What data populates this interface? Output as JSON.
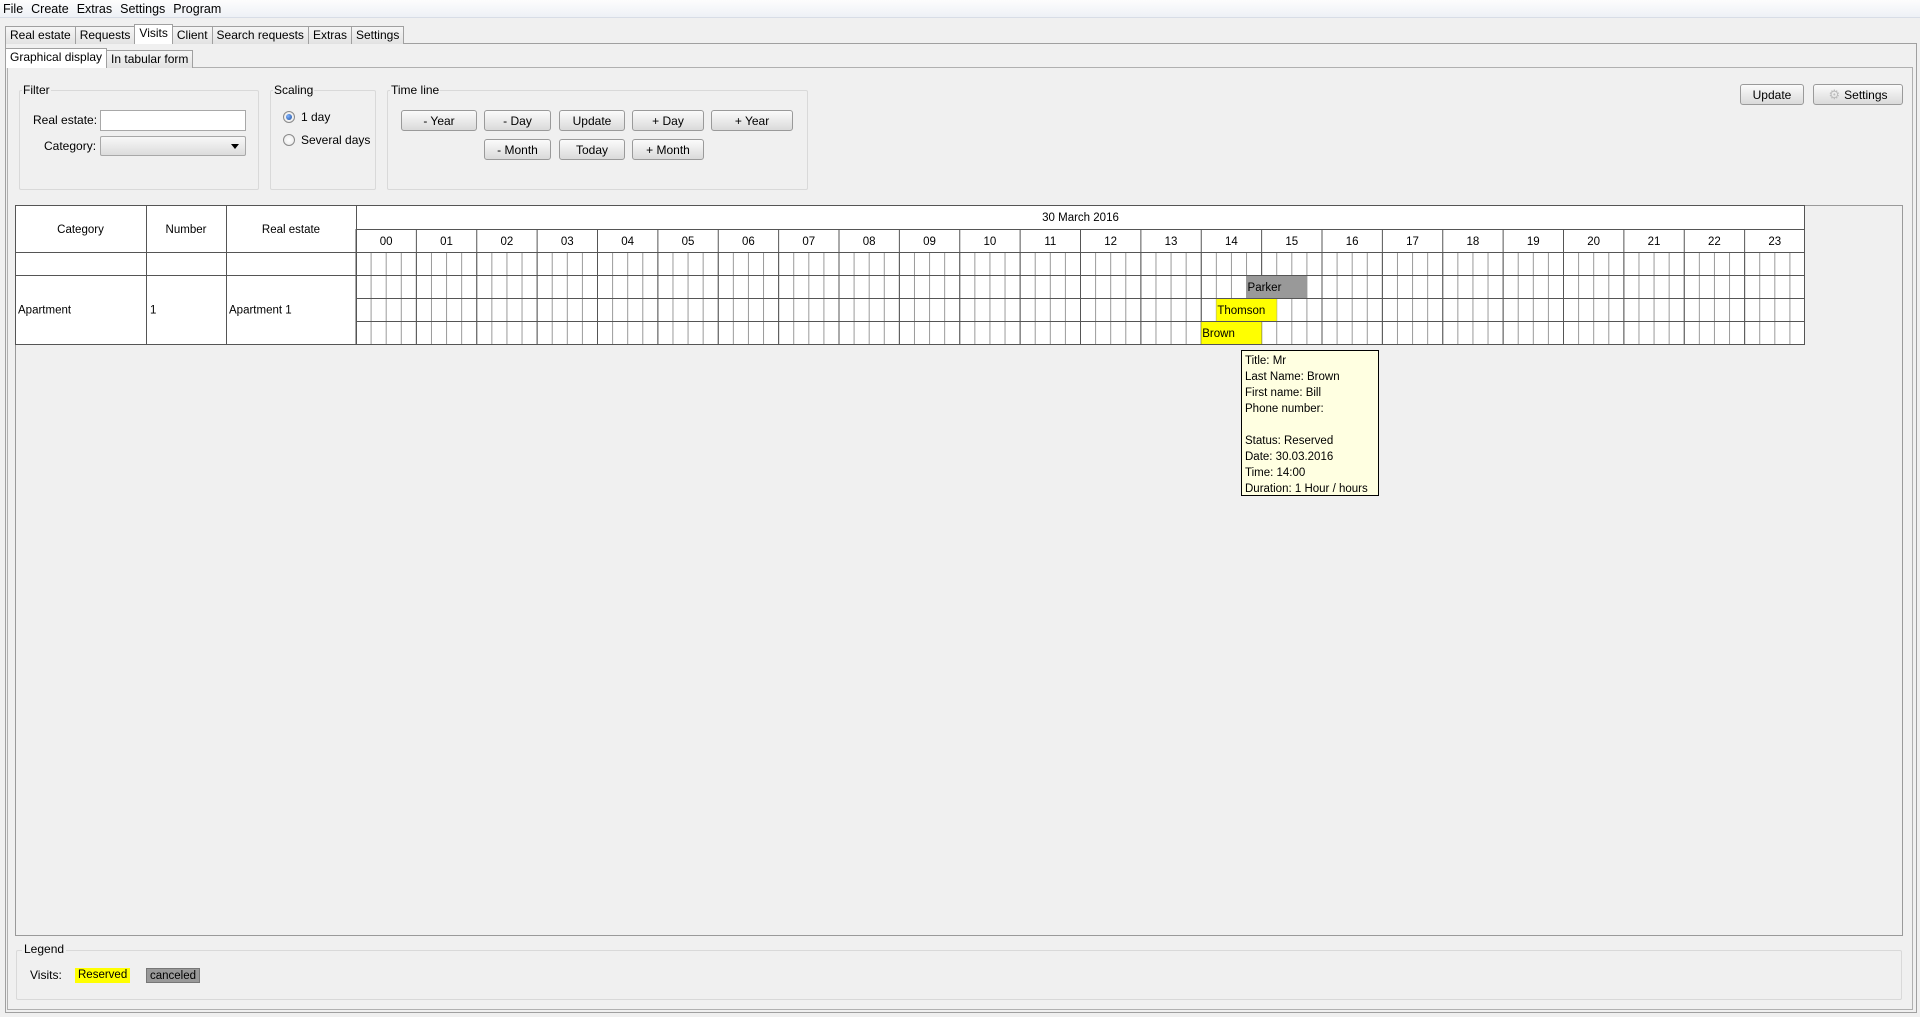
{
  "menu": [
    "File",
    "Create",
    "Extras",
    "Settings",
    "Program"
  ],
  "main_tabs": [
    "Real estate",
    "Requests",
    "Visits",
    "Client",
    "Search requests",
    "Extras",
    "Settings"
  ],
  "sub_tabs": [
    "Graphical display",
    "In tabular form"
  ],
  "filter": {
    "title": "Filter",
    "real_estate_label": "Real estate:",
    "real_estate_value": "",
    "category_label": "Category:",
    "category_value": ""
  },
  "scaling": {
    "title": "Scaling",
    "options": [
      "1 day",
      "Several days"
    ],
    "selected": "1 day"
  },
  "timeline": {
    "title": "Time line",
    "buttons_row1": [
      "- Year",
      "- Day",
      "Update",
      "+ Day",
      "+ Year"
    ],
    "buttons_row2": [
      "- Month",
      "Today",
      "+ Month"
    ]
  },
  "top_right": {
    "update_label": "Update",
    "settings_label": "Settings"
  },
  "grid": {
    "headers": [
      "Category",
      "Number",
      "Real estate"
    ],
    "date": "30 March 2016",
    "hours": [
      "00",
      "01",
      "02",
      "03",
      "04",
      "05",
      "06",
      "07",
      "08",
      "09",
      "10",
      "11",
      "12",
      "13",
      "14",
      "15",
      "16",
      "17",
      "18",
      "19",
      "20",
      "21",
      "22",
      "23"
    ],
    "rows": [
      {
        "category": "Apartment",
        "number": "1",
        "real_estate": "Apartment 1"
      }
    ],
    "visits": [
      {
        "name": "Parker",
        "status": "canceled",
        "lane": 0,
        "start_hour": 14.75,
        "duration_hours": 1
      },
      {
        "name": "Thomson",
        "status": "Reserved",
        "lane": 1,
        "start_hour": 14.25,
        "duration_hours": 1
      },
      {
        "name": "Brown",
        "status": "Reserved",
        "lane": 2,
        "start_hour": 14.0,
        "duration_hours": 1
      }
    ],
    "colors": {
      "Reserved": "#ffff00",
      "canceled": "#999999"
    }
  },
  "tooltip": {
    "lines": [
      "Title: Mr",
      "Last Name: Brown",
      "First name: Bill",
      "Phone number:",
      "",
      "Status: Reserved",
      "Date: 30.03.2016",
      "Time: 14:00",
      "Duration: 1 Hour / hours"
    ]
  },
  "legend": {
    "title": "Legend",
    "visits_label": "Visits:",
    "reserved_label": "Reserved",
    "canceled_label": "canceled"
  }
}
